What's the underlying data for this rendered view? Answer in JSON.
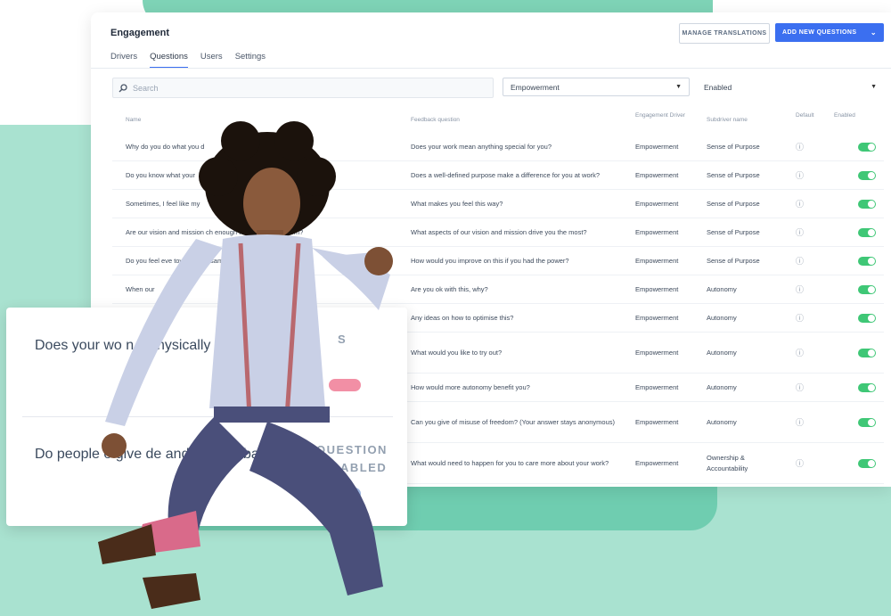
{
  "colors": {
    "accent": "#3b6ff0",
    "toggle_on": "#3fc776",
    "mint": "#a9e2d0",
    "mint_dark": "#6fcdb0"
  },
  "panel": {
    "title": "Engagement",
    "manage_btn": "MANAGE TRANSLATIONS",
    "add_btn": "ADD NEW QUESTIONS",
    "tabs": [
      "Drivers",
      "Questions",
      "Users",
      "Settings"
    ],
    "active_tab": "Questions",
    "search_placeholder": "Search",
    "driver_filter": "Empowerment",
    "status_filter": "Enabled",
    "columns": {
      "name": "Name",
      "feedback": "Feedback question",
      "driver": "Engagement Driver",
      "subdriver": "Subdriver name",
      "default": "Default",
      "enabled": "Enabled"
    },
    "rows": [
      {
        "name": "Why do you do what you d",
        "feedback": "Does your work mean anything special for you?",
        "driver": "Empowerment",
        "subdriver": "Sense of Purpose"
      },
      {
        "name": "Do you know what your",
        "feedback": "Does a well-defined purpose make a difference for you at work?",
        "driver": "Empowerment",
        "subdriver": "Sense of Purpose"
      },
      {
        "name": "Sometimes, I feel like my",
        "feedback": "What makes you feel this way?",
        "driver": "Empowerment",
        "subdriver": "Sense of Purpose"
      },
      {
        "name": "Are our vision and mission ch            enough to be driven by them?",
        "feedback": "What aspects of our vision and mission drive you the most?",
        "driver": "Empowerment",
        "subdriver": "Sense of Purpose"
      },
      {
        "name": "Do you feel eve                      towards the same com",
        "feedback": "How would you improve on this if you had the power?",
        "driver": "Empowerment",
        "subdriver": "Sense of Purpose"
      },
      {
        "name": "When our",
        "feedback": "Are you ok with this, why?",
        "driver": "Empowerment",
        "subdriver": "Autonomy"
      },
      {
        "name": "",
        "feedback": "Any ideas on how to optimise this?",
        "driver": "Empowerment",
        "subdriver": "Autonomy"
      },
      {
        "name": "",
        "feedback": "What would you like to try out?",
        "driver": "Empowerment",
        "subdriver": "Autonomy"
      },
      {
        "name": "",
        "feedback": "How would more autonomy benefit you?",
        "driver": "Empowerment",
        "subdriver": "Autonomy"
      },
      {
        "name": "",
        "feedback": "Can you give of misuse of freedom? (Your answer stays anonymous)",
        "driver": "Empowerment",
        "subdriver": "Autonomy"
      },
      {
        "name": "",
        "feedback": "What would need to happen for you to care more about your work?",
        "driver": "Empowerment",
        "subdriver": "Ownership & Accountability"
      }
    ]
  },
  "card": {
    "q1": "Does your wo        n y         physically a       while?",
    "q2": "Do people       e give de         and spec       edback?",
    "status_s": "S",
    "status": "QUESTION DISABLED"
  }
}
